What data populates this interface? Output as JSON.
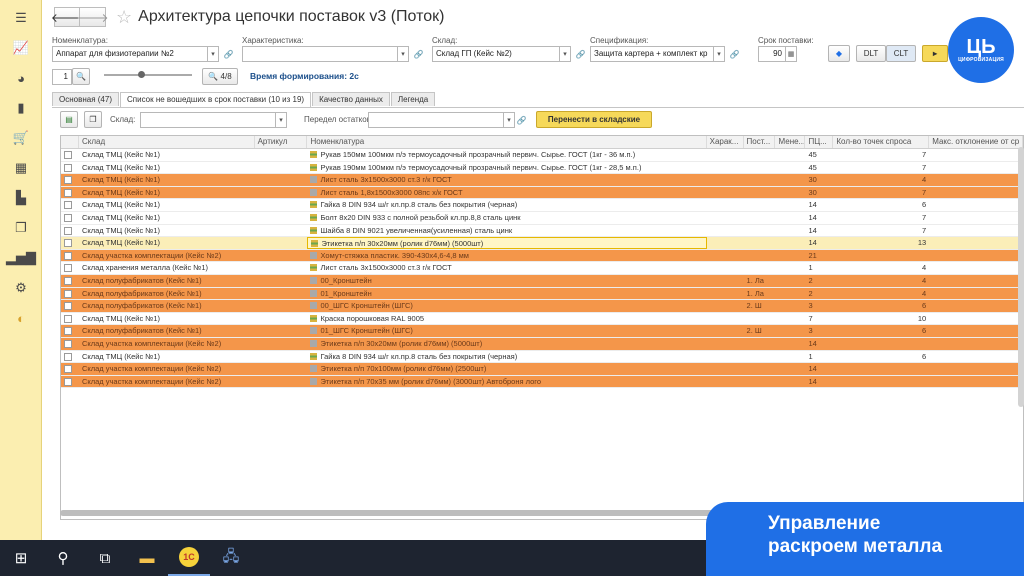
{
  "window": {
    "title": "Архитектура цепочки поставок v3 (Поток)"
  },
  "sidebar": {
    "icons": [
      "menu-icon",
      "chart-icon",
      "pie-icon",
      "bag-icon",
      "cart-icon",
      "grid-icon",
      "factory-icon",
      "documents-icon",
      "bar-chart-icon",
      "gear-icon",
      "refresh-icon"
    ]
  },
  "filters": {
    "nomenclature_label": "Номенклатура:",
    "nomenclature_value": "Аппарат для физиотерапии №2",
    "characteristic_label": "Характеристика:",
    "characteristic_value": "",
    "warehouse_label": "Склад:",
    "warehouse_value": "Склад ГП (Кейс №2)",
    "spec_label": "Спецификация:",
    "spec_value": "Защита картера + комплект кр",
    "lead_label": "Срок поставки:",
    "lead_value": "90",
    "dlt_label": "DLT",
    "clt_label": "CLT"
  },
  "toolbar2": {
    "scale_value": "1",
    "page_value": "4/8",
    "gen_time": "Время формирования: 2с"
  },
  "tabs": [
    {
      "label": "Основная (47)"
    },
    {
      "label": "Список не вошедших в срок поставки (10 из 19)"
    },
    {
      "label": "Качество данных"
    },
    {
      "label": "Легенда"
    }
  ],
  "filterbar": {
    "warehouse_label": "Склад:",
    "warehouse_value": "",
    "before_label": "Передел остатков:",
    "before_value": "",
    "move_button": "Перенести в складские"
  },
  "grid": {
    "headers": [
      "Склад",
      "Артикул",
      "Номенклатура",
      "Харак...",
      "Пост...",
      "Мене...",
      "ПЦ...",
      "Кол-во точек спроса",
      "Макс. отклонение от ср"
    ],
    "rows": [
      {
        "style": "",
        "sklad": "Склад ТМЦ (Кейс №1)",
        "nom": "Рукав 150мм 100мкм п/э термоусадочный прозрачный первич. Сырье. ГОСТ (1кг - 36 м.п.)",
        "icon": "st",
        "har": "",
        "post": "",
        "men": "",
        "pc": "45",
        "cnt": "7"
      },
      {
        "style": "",
        "sklad": "Склад ТМЦ (Кейс №1)",
        "nom": "Рукав 190мм 100мкм п/э термоусадочный прозрачный первич. Сырье. ГОСТ (1кг - 28,5 м.п.)",
        "icon": "st",
        "har": "",
        "post": "",
        "men": "",
        "pc": "45",
        "cnt": "7"
      },
      {
        "style": "orange",
        "sklad": "Склад ТМЦ (Кейс №1)",
        "nom": "Лист сталь 3х1500х3000 ст.3 г/к ГОСТ",
        "icon": "gr",
        "har": "",
        "post": "",
        "men": "",
        "pc": "30",
        "cnt": "4"
      },
      {
        "style": "orange",
        "sklad": "Склад ТМЦ (Кейс №1)",
        "nom": "Лист сталь 1,8х1500х3000 08пс х/к ГОСТ",
        "icon": "gr",
        "har": "",
        "post": "",
        "men": "",
        "pc": "30",
        "cnt": "7"
      },
      {
        "style": "",
        "sklad": "Склад ТМЦ (Кейс №1)",
        "nom": "Гайка 8 DIN 934 ш/г кл.пр.8 сталь без покрытия (черная)",
        "icon": "st",
        "har": "",
        "post": "",
        "men": "",
        "pc": "14",
        "cnt": "6"
      },
      {
        "style": "",
        "sklad": "Склад ТМЦ (Кейс №1)",
        "nom": "Болт 8х20 DIN 933 с полной резьбой кл.пр.8,8 сталь цинк",
        "icon": "st",
        "har": "",
        "post": "",
        "men": "",
        "pc": "14",
        "cnt": "7"
      },
      {
        "style": "",
        "sklad": "Склад ТМЦ (Кейс №1)",
        "nom": "Шайба 8 DIN 9021 увеличенная(усиленная) сталь цинк",
        "icon": "st",
        "har": "",
        "post": "",
        "men": "",
        "pc": "14",
        "cnt": "7"
      },
      {
        "style": "hl",
        "sklad": "Склад ТМЦ (Кейс №1)",
        "nom": "Этикетка п/п 30х20мм (ролик d76мм) (5000шт)",
        "icon": "st",
        "har": "",
        "post": "",
        "men": "",
        "pc": "14",
        "cnt": "13"
      },
      {
        "style": "orange",
        "sklad": "Склад участка комплектации (Кейс №2)",
        "nom": "Хомут-стяжка пластик. 390-430х4,6-4,8 мм",
        "icon": "gr",
        "har": "",
        "post": "",
        "men": "",
        "pc": "21",
        "cnt": ""
      },
      {
        "style": "",
        "sklad": "Склад хранения металла (Кейс №1)",
        "nom": "Лист сталь 3х1500х3000 ст.3 г/к ГОСТ",
        "icon": "st",
        "har": "",
        "post": "",
        "men": "",
        "pc": "1",
        "cnt": "4"
      },
      {
        "style": "orange",
        "sklad": "Склад полуфабрикатов (Кейс №1)",
        "nom": "00_Кронштейн",
        "icon": "gr",
        "har": "",
        "post": "1. Ла",
        "men": "",
        "pc": "2",
        "cnt": "4"
      },
      {
        "style": "orange",
        "sklad": "Склад полуфабрикатов (Кейс №1)",
        "nom": "01_Кронштейн",
        "icon": "gr",
        "har": "",
        "post": "1. Ла",
        "men": "",
        "pc": "2",
        "cnt": "4"
      },
      {
        "style": "orange",
        "sklad": "Склад полуфабрикатов (Кейс №1)",
        "nom": "00_ШГС Кронштейн (ШГС)",
        "icon": "gr",
        "har": "",
        "post": "2. Ш",
        "men": "",
        "pc": "3",
        "cnt": "6"
      },
      {
        "style": "",
        "sklad": "Склад ТМЦ (Кейс №1)",
        "nom": "Краска порошковая RAL 9005",
        "icon": "st",
        "har": "",
        "post": "",
        "men": "",
        "pc": "7",
        "cnt": "10"
      },
      {
        "style": "orange",
        "sklad": "Склад полуфабрикатов (Кейс №1)",
        "nom": "01_ШГС Кронштейн (ШГС)",
        "icon": "gr",
        "har": "",
        "post": "2. Ш",
        "men": "",
        "pc": "3",
        "cnt": "6"
      },
      {
        "style": "orange",
        "sklad": "Склад участка комплектации (Кейс №2)",
        "nom": "Этикетка п/п 30х20мм (ролик d76мм) (5000шт)",
        "icon": "gr",
        "har": "",
        "post": "",
        "men": "",
        "pc": "14",
        "cnt": ""
      },
      {
        "style": "",
        "sklad": "Склад ТМЦ (Кейс №1)",
        "nom": "Гайка 8 DIN 934 ш/г кл.пр.8 сталь без покрытия (черная)",
        "icon": "st",
        "har": "",
        "post": "",
        "men": "",
        "pc": "1",
        "cnt": "6"
      },
      {
        "style": "orange",
        "sklad": "Склад участка комплектации (Кейс №2)",
        "nom": "Этикетка п/п 70х100мм (ролик d76мм) (2500шт)",
        "icon": "gr",
        "har": "",
        "post": "",
        "men": "",
        "pc": "14",
        "cnt": ""
      },
      {
        "style": "orange",
        "sklad": "Склад участка комплектации (Кейс №2)",
        "nom": "Этикетка п/п 70х35 мм (ролик d76мм) (3000шт) Автоброня лого",
        "icon": "gr",
        "har": "",
        "post": "",
        "men": "",
        "pc": "14",
        "cnt": ""
      }
    ]
  },
  "taskbar": {
    "items": [
      "windows-icon",
      "search-icon",
      "task-view-icon",
      "explorer-icon",
      "1c-icon",
      "network-icon"
    ]
  },
  "brand": {
    "logo_text": "ЦИФРОВИЗАЦИЯ",
    "caption_line1": "Управление",
    "caption_line2": "раскроем металла"
  }
}
